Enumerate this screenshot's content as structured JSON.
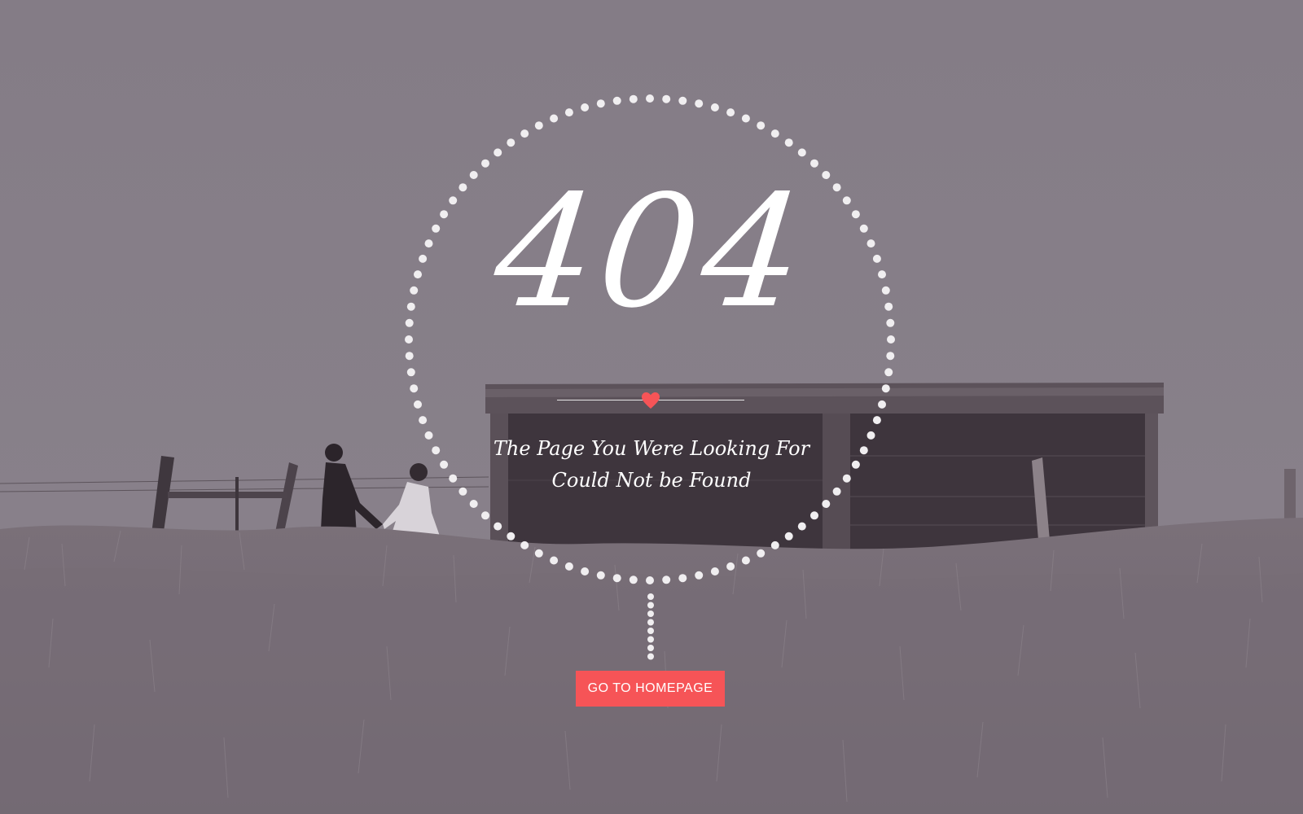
{
  "error": {
    "code": "404",
    "message_line1": "The Page You Were Looking  For",
    "message_line2": "Could Not be Found"
  },
  "actions": {
    "home_label": "GO TO HOMEPAGE"
  },
  "icons": {
    "divider": "heart-icon"
  },
  "colors": {
    "background_tint": "#867f88",
    "accent": "#f65457",
    "text": "#ffffff",
    "dots": "#f0eef0"
  }
}
